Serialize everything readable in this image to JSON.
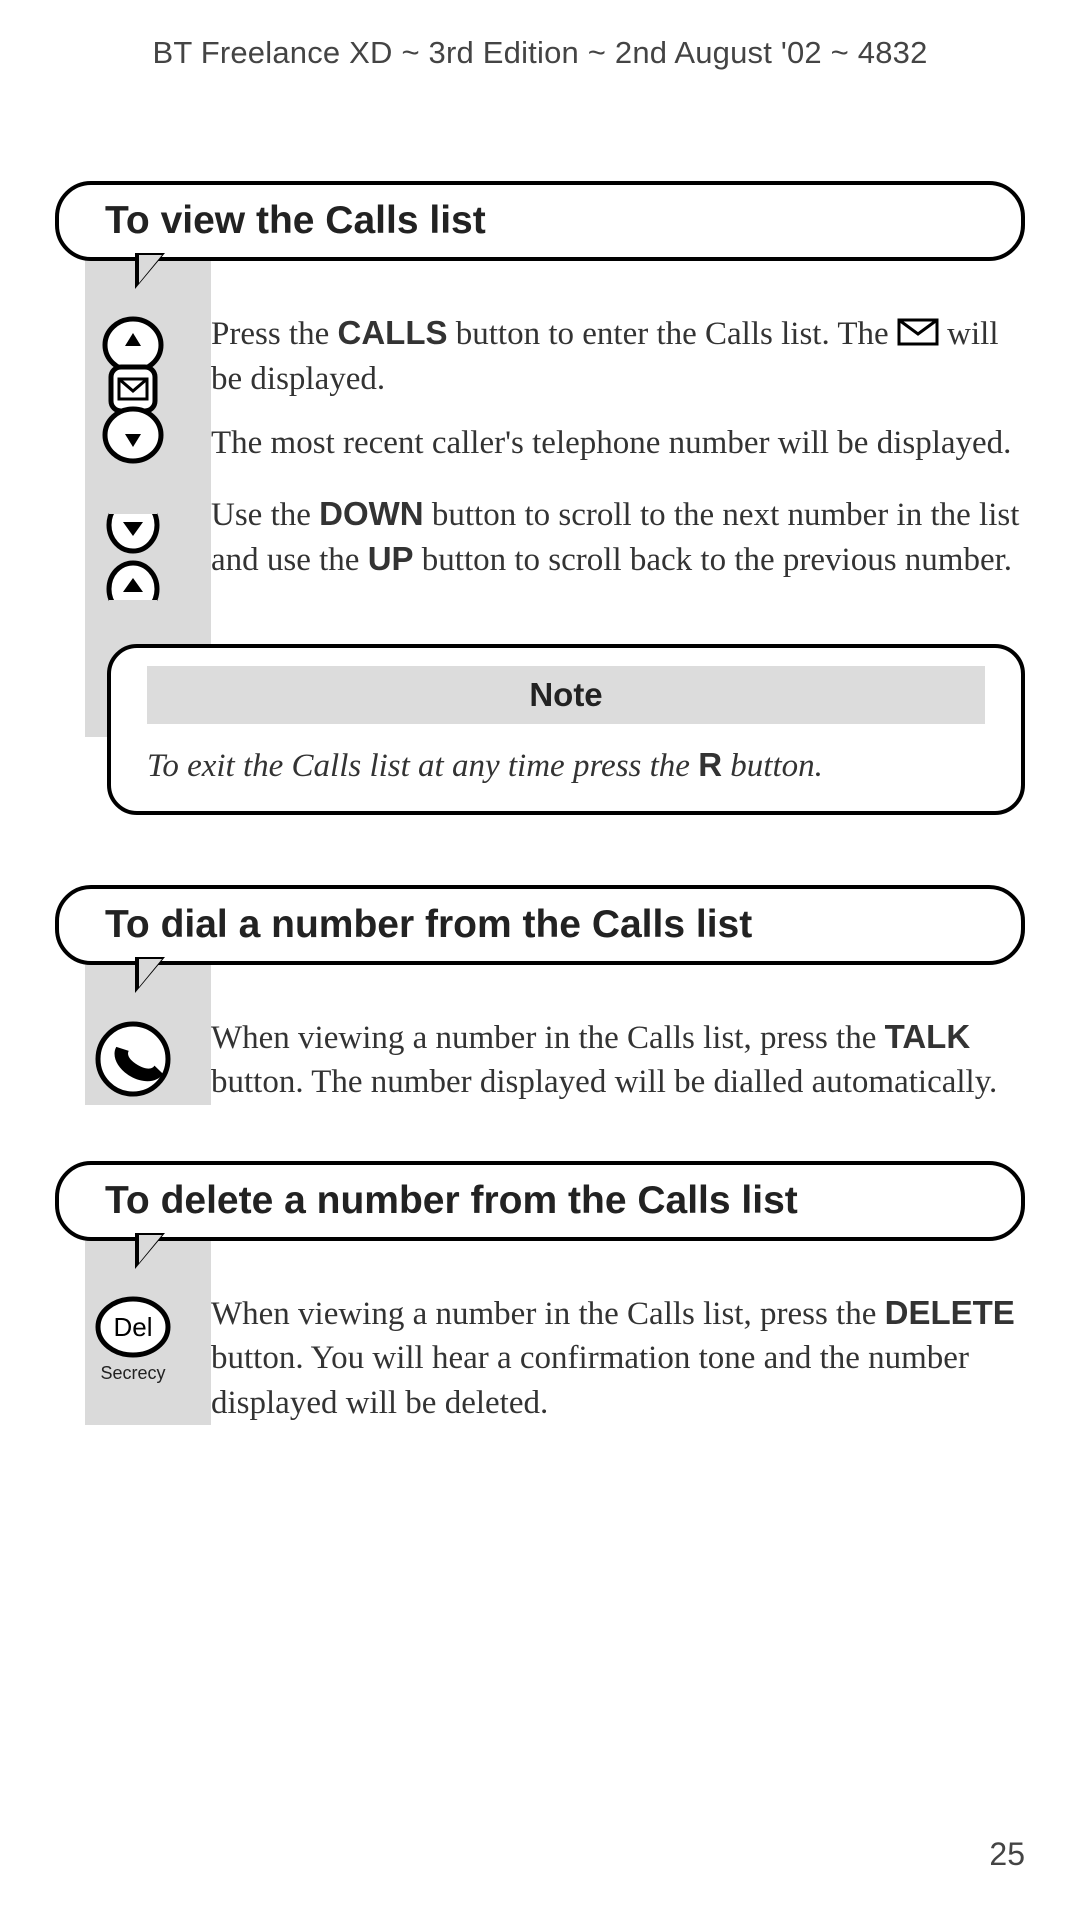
{
  "header": "BT Freelance XD ~ 3rd Edition ~ 2nd August '02 ~ 4832",
  "page_number": "25",
  "sections": {
    "view": {
      "title": "To view the Calls list",
      "step1_pre": "Press the ",
      "step1_bold": "CALLS",
      "step1_mid": " button to enter the Calls list. The ",
      "step1_post": " will be displayed.",
      "step2": "The most recent caller's telephone number will be displayed.",
      "step3_pre": "Use the ",
      "step3_bold1": "DOWN",
      "step3_mid1": " button to scroll to the next number in the list and use the ",
      "step3_bold2": "UP",
      "step3_post": " button to scroll back to the previous number."
    },
    "note": {
      "title": "Note",
      "text_pre": "To exit the Calls list at any time press the ",
      "text_bold": "R",
      "text_post": " button."
    },
    "dial": {
      "title": "To dial a number from the Calls list",
      "step1_pre": "When viewing a number in the Calls list, press the ",
      "step1_bold": "TALK",
      "step1_post": " button. The number displayed will be dialled automatically."
    },
    "delete": {
      "title": "To delete a number from the Calls list",
      "del_label": "Del",
      "secrecy_label": "Secrecy",
      "step1_pre": "When viewing a number in the Calls list, press the ",
      "step1_bold": "DELETE",
      "step1_post": " button. You will hear a confirmation tone and the number displayed will be deleted."
    }
  }
}
